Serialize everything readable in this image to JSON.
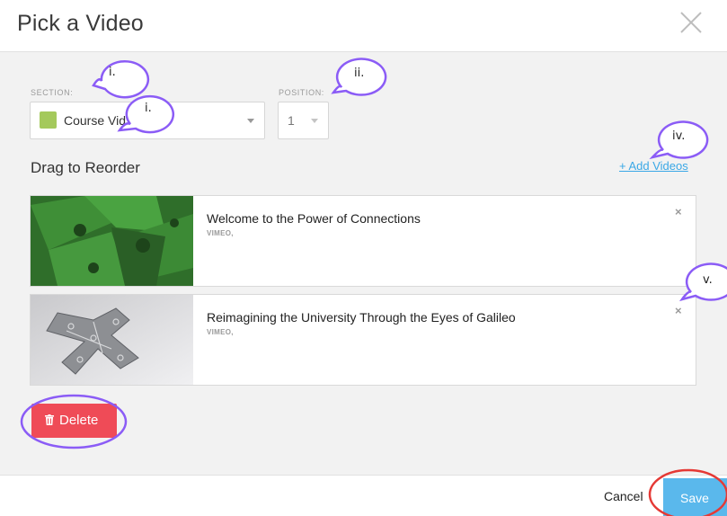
{
  "dialog": {
    "title": "Pick a Video"
  },
  "section": {
    "label": "SECTION:",
    "value": "Course Vid",
    "swatch_color": "#a4c95c"
  },
  "position": {
    "label": "POSITION:",
    "value": "1"
  },
  "list": {
    "title": "Drag to Reorder",
    "add_label": "+ Add Videos"
  },
  "videos": [
    {
      "title": "Welcome to the Power of Connections",
      "source": "VIMEO,",
      "remove": "×"
    },
    {
      "title": "Reimagining the University Through the Eyes of Galileo",
      "source": "VIMEO,",
      "remove": "×"
    }
  ],
  "actions": {
    "delete_label": "Delete",
    "cancel_label": "Cancel",
    "save_label": "Save"
  },
  "annotations": {
    "callouts": [
      "i.",
      "i.",
      "ii.",
      "iv.",
      "v."
    ],
    "callout_color": "#8b5cf6",
    "circle_color": "#8b5cf6",
    "save_circle_color": "#e53935"
  },
  "colors": {
    "delete": "#ef4b57",
    "save": "#5ab8ec",
    "link": "#3aa8e6"
  }
}
